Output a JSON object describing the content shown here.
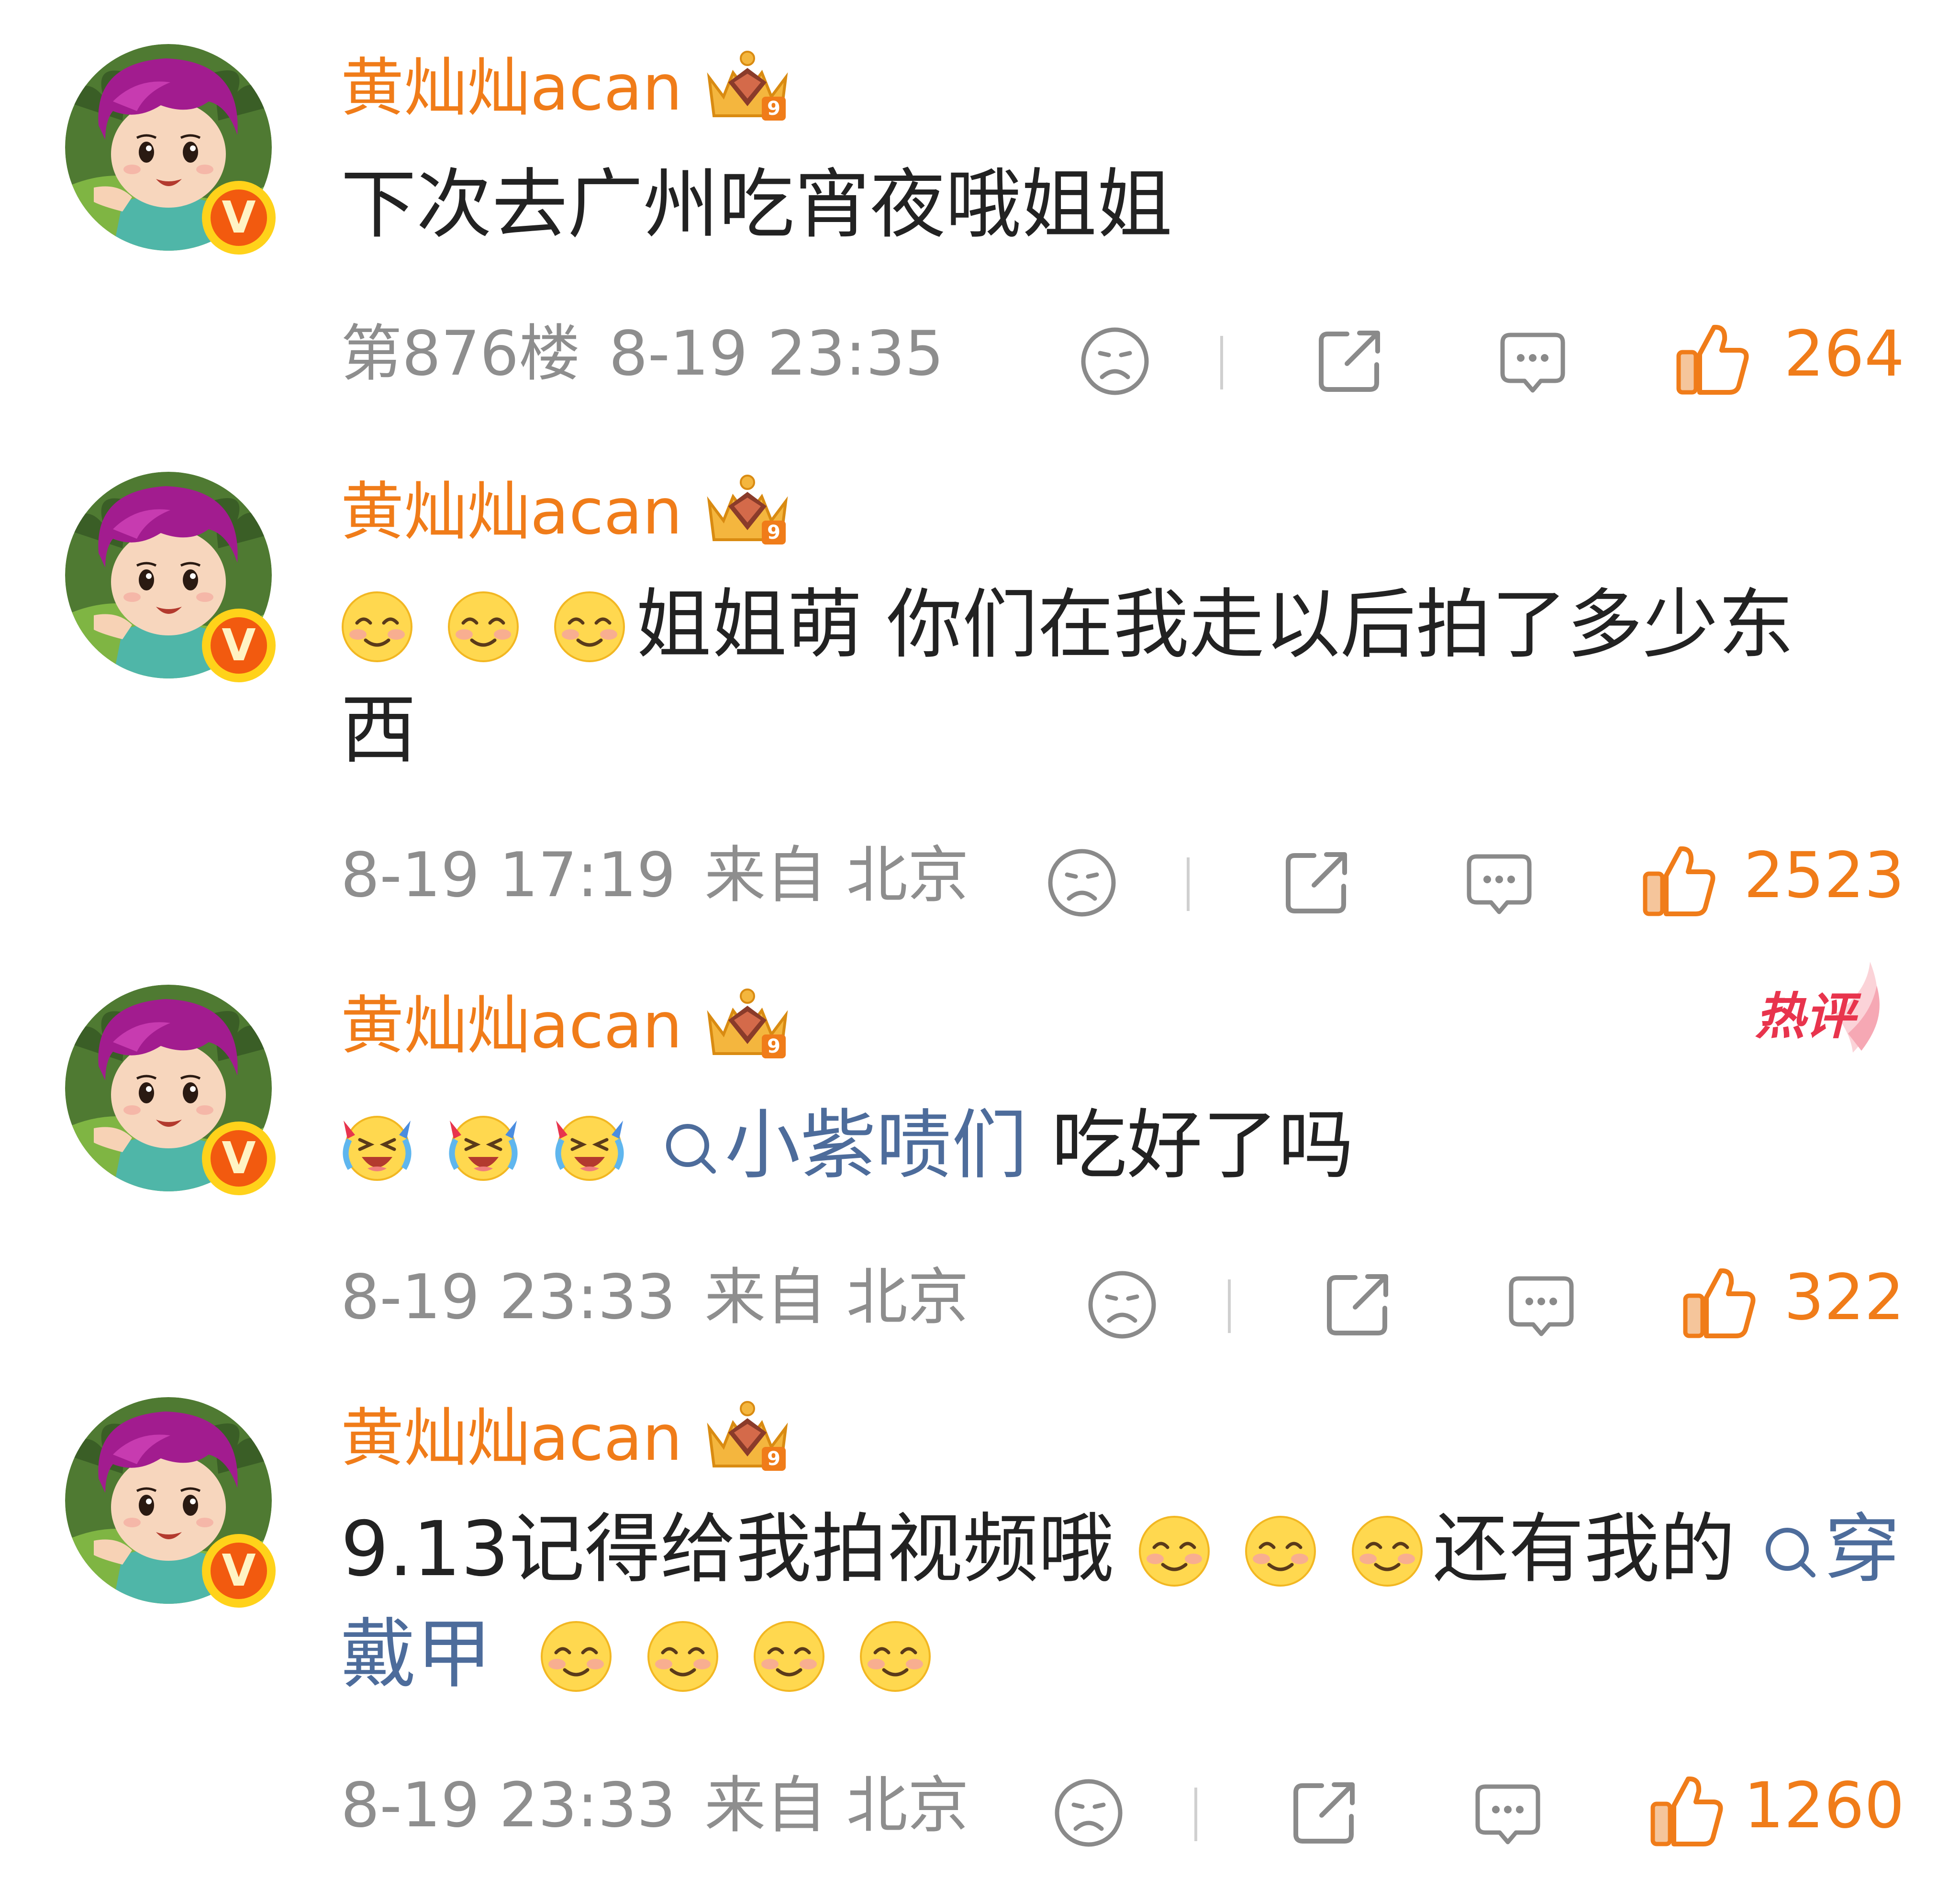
{
  "comments": [
    {
      "username": "黄灿灿acan",
      "text": [
        {
          "type": "text",
          "value": "下次去广州吃宵夜哦姐姐"
        }
      ],
      "meta": [
        "第876楼",
        "8-19 23:35"
      ],
      "likes": "264",
      "hot": false
    },
    {
      "username": "黄灿灿acan",
      "text": [
        {
          "type": "emoji",
          "name": "smile-emoji"
        },
        {
          "type": "emoji",
          "name": "smile-emoji"
        },
        {
          "type": "emoji",
          "name": "smile-emoji"
        },
        {
          "type": "text",
          "value": "姐姐萌 你们在我走以后拍了多少东西"
        }
      ],
      "meta": [
        "8-19 17:19",
        "来自 北京"
      ],
      "likes": "2523",
      "hot": false
    },
    {
      "username": "黄灿灿acan",
      "text": [
        {
          "type": "emoji",
          "name": "laugh-cry-emoji"
        },
        {
          "type": "emoji",
          "name": "laugh-cry-emoji"
        },
        {
          "type": "emoji",
          "name": "laugh-cry-emoji"
        },
        {
          "type": "topic",
          "value": "小紫啧们"
        },
        {
          "type": "text",
          "value": " 吃好了吗"
        }
      ],
      "meta": [
        "8-19 23:33",
        "来自 北京"
      ],
      "likes": "322",
      "hot": true
    },
    {
      "username": "黄灿灿acan",
      "text": [
        {
          "type": "text",
          "value": "9.13记得给我拍视频哦"
        },
        {
          "type": "emoji",
          "name": "smile-emoji"
        },
        {
          "type": "emoji",
          "name": "smile-emoji"
        },
        {
          "type": "emoji",
          "name": "smile-emoji"
        },
        {
          "type": "text",
          "value": "还有我的"
        },
        {
          "type": "topic",
          "value": "穿戴甲"
        },
        {
          "type": "text",
          "value": " "
        },
        {
          "type": "emoji",
          "name": "smile-emoji"
        },
        {
          "type": "emoji",
          "name": "smile-emoji"
        },
        {
          "type": "emoji",
          "name": "smile-emoji"
        },
        {
          "type": "emoji",
          "name": "smile-emoji"
        }
      ],
      "meta": [
        "8-19 23:33",
        "来自 北京"
      ],
      "likes": "1260",
      "hot": false
    }
  ],
  "hot_label": "热评",
  "icons": {
    "verified": "verified-v-badge-icon",
    "crown": "vip-crown-9-icon",
    "dislike": "sad-face-dislike-icon",
    "share": "share-icon",
    "reply": "comment-bubble-icon",
    "like": "thumbs-up-icon",
    "topic": "search-topic-icon"
  },
  "verified_letter": "V",
  "crown_level": "9",
  "colors": {
    "username": "#f07c19",
    "text": "#222222",
    "meta": "#8e8e8e",
    "topic": "#4d6c9b",
    "like": "#f07c19",
    "hot": "#e8344d",
    "badge": "#f25a0f"
  }
}
